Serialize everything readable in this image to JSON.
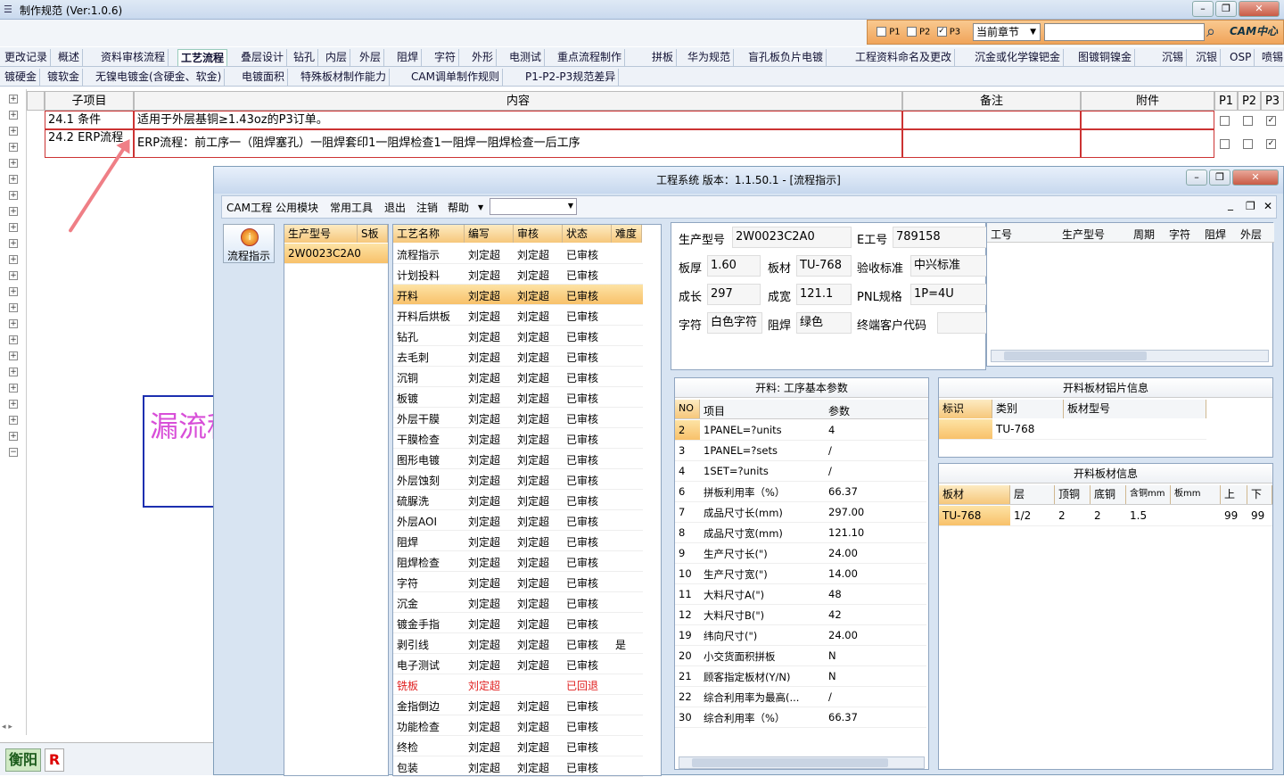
{
  "app": {
    "title": "制作规范 (Ver:1.0.6)"
  },
  "toolbar": {
    "p1": "P1",
    "p2": "P2",
    "p3": "P3",
    "chapter_select": "当前章节",
    "logo": "CAM中心"
  },
  "tabs_row1": [
    "更改记录",
    "概述",
    "资料审核流程",
    "工艺流程",
    "叠层设计",
    "钻孔",
    "内层",
    "外层",
    "阻焊",
    "字符",
    "外形",
    "电测试",
    "重点流程制作",
    "拼板",
    "华为规范",
    "盲孔板负片电镀",
    "工程资料命名及更改",
    "沉金或化学镍钯金",
    "图镀铜镍金",
    "沉锡",
    "沉银",
    "OSP",
    "喷锡"
  ],
  "tabs_row2": [
    "镀硬金",
    "镀软金",
    "无镍电镀金(含硬金、软金)",
    "电镀面积",
    "特殊板材制作能力",
    "CAM调单制作规则",
    "P1-P2-P3规范差异"
  ],
  "grid": {
    "headers": {
      "sub": "子项目",
      "content": "内容",
      "note": "备注",
      "attach": "附件",
      "p1": "P1",
      "p2": "P2",
      "p3": "P3"
    },
    "rows": [
      {
        "sub": "24.1 条件",
        "content": "适用于外层基铜≥1.43oz的P3订单。"
      },
      {
        "sub": "24.2 ERP流程",
        "content": "ERP流程：前工序一（阻焊塞孔）一阻焊套印1一阻焊检查1一阻焊一阻焊检查一后工序"
      }
    ]
  },
  "annotation": {
    "text": "漏流程"
  },
  "status": {
    "city": "衡阳",
    "r": "R"
  },
  "dialog": {
    "title": "工程系统  版本：1.1.50.1 - [流程指示]",
    "menu": [
      "CAM工程",
      "公用模块",
      "常用工具",
      "退出",
      "注销",
      "帮助"
    ],
    "side_button": "流程指示",
    "list1": {
      "headers": [
        "生产型号",
        "S板"
      ],
      "rows": [
        "2W0023C2A0"
      ]
    },
    "flow": {
      "headers": [
        "工艺名称",
        "编写",
        "审核",
        "状态",
        "难度"
      ],
      "rows": [
        [
          "流程指示",
          "刘定超",
          "刘定超",
          "已审核",
          ""
        ],
        [
          "计划投料",
          "刘定超",
          "刘定超",
          "已审核",
          ""
        ],
        [
          "开料",
          "刘定超",
          "刘定超",
          "已审核",
          ""
        ],
        [
          "开料后烘板",
          "刘定超",
          "刘定超",
          "已审核",
          ""
        ],
        [
          "钻孔",
          "刘定超",
          "刘定超",
          "已审核",
          ""
        ],
        [
          "去毛刺",
          "刘定超",
          "刘定超",
          "已审核",
          ""
        ],
        [
          "沉铜",
          "刘定超",
          "刘定超",
          "已审核",
          ""
        ],
        [
          "板镀",
          "刘定超",
          "刘定超",
          "已审核",
          ""
        ],
        [
          "外层干膜",
          "刘定超",
          "刘定超",
          "已审核",
          ""
        ],
        [
          "干膜检查",
          "刘定超",
          "刘定超",
          "已审核",
          ""
        ],
        [
          "图形电镀",
          "刘定超",
          "刘定超",
          "已审核",
          ""
        ],
        [
          "外层蚀刻",
          "刘定超",
          "刘定超",
          "已审核",
          ""
        ],
        [
          "硫脲洗",
          "刘定超",
          "刘定超",
          "已审核",
          ""
        ],
        [
          "外层AOI",
          "刘定超",
          "刘定超",
          "已审核",
          ""
        ],
        [
          "阻焊",
          "刘定超",
          "刘定超",
          "已审核",
          ""
        ],
        [
          "阻焊检查",
          "刘定超",
          "刘定超",
          "已审核",
          ""
        ],
        [
          "字符",
          "刘定超",
          "刘定超",
          "已审核",
          ""
        ],
        [
          "沉金",
          "刘定超",
          "刘定超",
          "已审核",
          ""
        ],
        [
          "镀金手指",
          "刘定超",
          "刘定超",
          "已审核",
          ""
        ],
        [
          "剥引线",
          "刘定超",
          "刘定超",
          "已审核",
          "是"
        ],
        [
          "电子测试",
          "刘定超",
          "刘定超",
          "已审核",
          ""
        ],
        [
          "铣板",
          "刘定超",
          "",
          "已回退",
          ""
        ],
        [
          "金指倒边",
          "刘定超",
          "刘定超",
          "已审核",
          ""
        ],
        [
          "功能检查",
          "刘定超",
          "刘定超",
          "已审核",
          ""
        ],
        [
          "终检",
          "刘定超",
          "刘定超",
          "已审核",
          ""
        ],
        [
          "包装",
          "刘定超",
          "刘定超",
          "已审核",
          ""
        ]
      ]
    },
    "info": {
      "model_label": "生产型号",
      "model": "2W0023C2A0",
      "eno_label": "E工号",
      "eno": "789158",
      "thick_label": "板厚",
      "thick": "1.60",
      "mat_label": "板材",
      "mat": "TU-768",
      "std_label": "验收标准",
      "std": "中兴标准",
      "len_label": "成长",
      "len": "297",
      "wid_label": "成宽",
      "wid": "121.1",
      "pnl_label": "PNL规格",
      "pnl": "1P=4U",
      "char_label": "字符",
      "char": "白色字符",
      "mask_label": "阻焊",
      "mask": "绿色",
      "cust_label": "终端客户代码",
      "cust": ""
    },
    "right_grid": {
      "headers": [
        "工号",
        "生产型号",
        "周期",
        "字符",
        "阻焊",
        "外层"
      ]
    },
    "params": {
      "title": "开料: 工序基本参数",
      "headers": [
        "NO",
        "项目",
        "参数"
      ],
      "rows": [
        [
          "2",
          "1PANEL=?units",
          "4"
        ],
        [
          "3",
          "1PANEL=?sets",
          "/"
        ],
        [
          "4",
          "1SET=?units",
          "/"
        ],
        [
          "6",
          "拼板利用率（%）",
          "66.37"
        ],
        [
          "7",
          "成品尺寸长(mm)",
          "297.00"
        ],
        [
          "8",
          "成品尺寸宽(mm)",
          "121.10"
        ],
        [
          "9",
          "生产尺寸长(\")",
          "24.00"
        ],
        [
          "10",
          "生产尺寸宽(\")",
          "14.00"
        ],
        [
          "11",
          "大料尺寸A(\")",
          "48"
        ],
        [
          "12",
          "大料尺寸B(\")",
          "42"
        ],
        [
          "19",
          "纬向尺寸(\")",
          "24.00"
        ],
        [
          "20",
          "小交货面积拼板",
          "N"
        ],
        [
          "21",
          "顾客指定板材(Y/N)",
          "N"
        ],
        [
          "22",
          "综合利用率为最高(...",
          "/"
        ],
        [
          "30",
          "综合利用率（%）",
          "66.37"
        ]
      ]
    },
    "plate_info": {
      "title": "开料板材铝片信息",
      "headers": [
        "标识",
        "类别",
        "板材型号"
      ],
      "rows": [
        [
          "",
          "TU-768",
          ""
        ]
      ]
    },
    "cut_info": {
      "title": "开料板材信息",
      "headers": [
        "板材",
        "层",
        "顶铜",
        "底铜",
        "含铜mm",
        "板mm",
        "上",
        "下"
      ],
      "rows": [
        [
          "TU-768",
          "1/2",
          "2",
          "2",
          "1.5",
          "",
          "99",
          "99"
        ]
      ]
    }
  }
}
